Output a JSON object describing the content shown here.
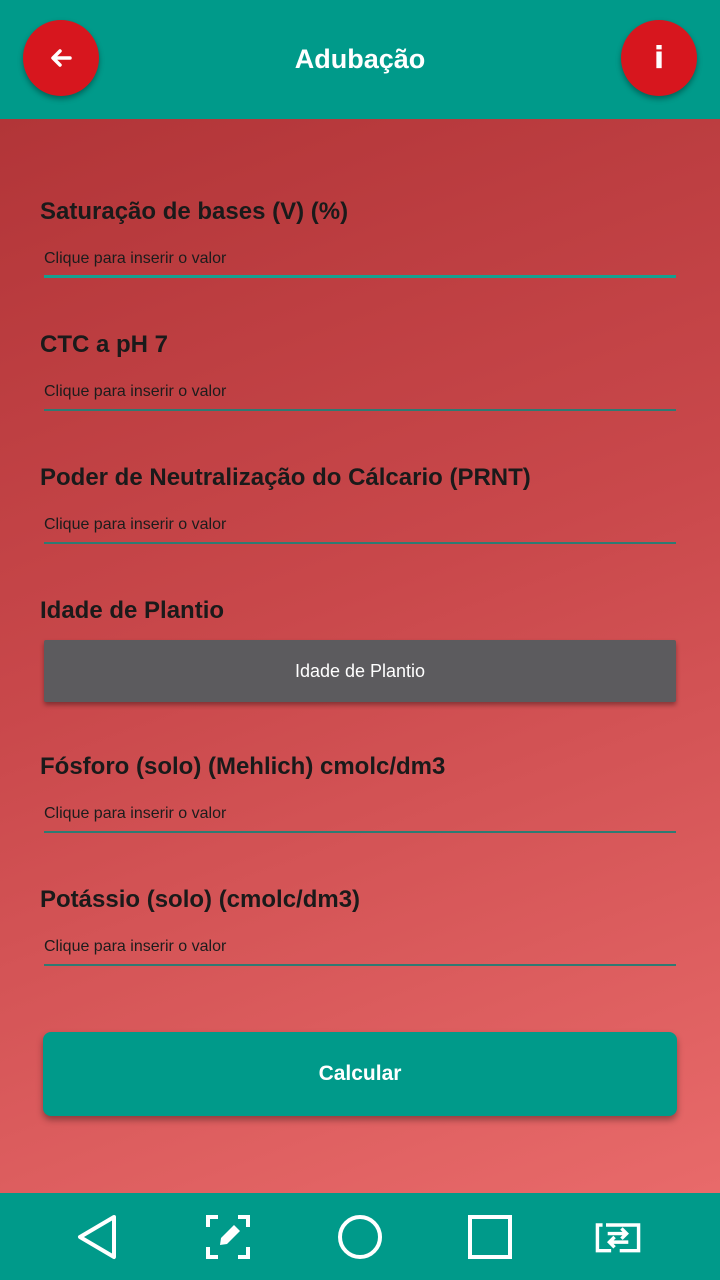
{
  "header": {
    "title": "Adubação",
    "back_icon": "arrow-left-icon",
    "info_label": "i"
  },
  "form": {
    "fields": [
      {
        "label": "Saturação de bases (V) (%)",
        "placeholder": "Clique para inserir o valor"
      },
      {
        "label": "CTC a pH 7",
        "placeholder": "Clique para inserir o valor"
      },
      {
        "label": "Poder de Neutralização do Cálcario (PRNT)",
        "placeholder": "Clique para inserir o valor"
      },
      {
        "label": "Idade de Plantio",
        "button_label": "Idade de Plantio"
      },
      {
        "label": "Fósforo (solo) (Mehlich) cmolc/dm3",
        "placeholder": "Clique para inserir o valor"
      },
      {
        "label": "Potássio (solo) (cmolc/dm3)",
        "placeholder": "Clique para inserir o valor"
      }
    ],
    "submit_label": "Calcular"
  },
  "navbar": {
    "icons": [
      "back-triangle-icon",
      "screenshot-edit-icon",
      "home-circle-icon",
      "recents-square-icon",
      "switch-app-icon"
    ]
  },
  "colors": {
    "header": "#009a8a",
    "accent_button": "#d7161e",
    "background_start": "#b23538",
    "background_end": "#e86a6a",
    "secondary_button": "#5c5b5e"
  }
}
